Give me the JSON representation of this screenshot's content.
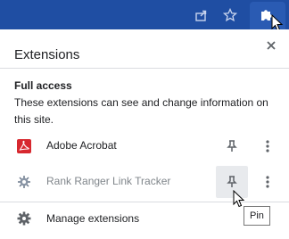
{
  "toolbar": {
    "share_icon": "share-icon",
    "star_icon": "star-icon",
    "extensions_icon": "puzzle-icon",
    "background_color": "#1f4ea3"
  },
  "panel": {
    "title": "Extensions",
    "close_icon": "close-icon",
    "full_access": {
      "heading": "Full access",
      "description": "These extensions can see and change information on this site."
    },
    "extensions": [
      {
        "name": "Adobe Acrobat",
        "icon": "adobe-acrobat-icon",
        "pinned": false,
        "muted": false
      },
      {
        "name": "Rank Ranger Link Tracker",
        "icon": "rank-ranger-icon",
        "pinned": false,
        "muted": true
      }
    ],
    "manage_label": "Manage extensions",
    "tooltip": "Pin"
  }
}
